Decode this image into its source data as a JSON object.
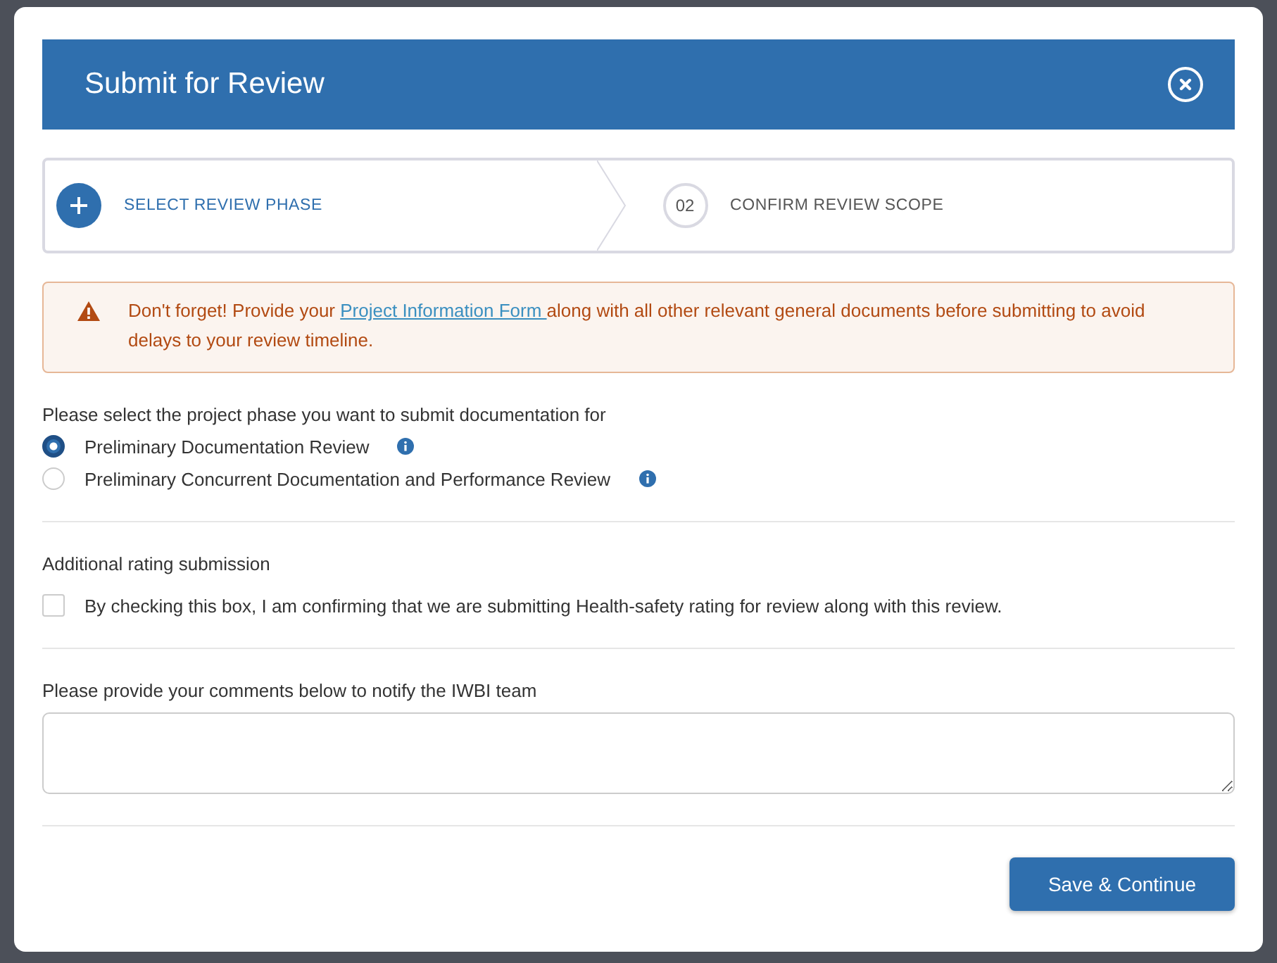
{
  "dialog": {
    "title": "Submit for Review"
  },
  "steps": [
    {
      "label": "SELECT REVIEW PHASE",
      "selected": true
    },
    {
      "number": "02",
      "label": "CONFIRM REVIEW SCOPE",
      "selected": false
    }
  ],
  "alert": {
    "before": "Don't forget! Provide your ",
    "link": "Project Information Form ",
    "after": "along with all other relevant general documents before submitting to avoid delays to your review timeline."
  },
  "phase": {
    "label": "Please select the project phase you want to submit documentation for",
    "options": [
      {
        "label": "Preliminary Documentation Review",
        "selected": true
      },
      {
        "label": "Preliminary Concurrent Documentation and Performance Review",
        "selected": false
      }
    ]
  },
  "additional": {
    "heading": "Additional rating submission",
    "checkbox": {
      "label": "By checking this box, I am confirming that we are submitting Health-safety rating for review along with this review.",
      "checked": false
    }
  },
  "comments": {
    "label": "Please provide your comments below to notify the IWBI team"
  },
  "buttons": [
    "Save & Continue"
  ]
}
